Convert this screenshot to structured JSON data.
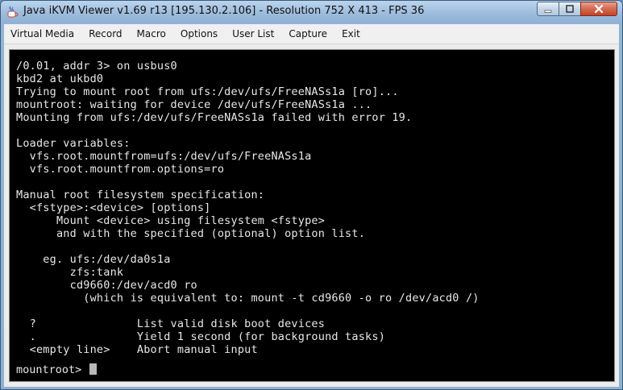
{
  "window": {
    "title": "Java iKVM Viewer v1.69 r13 [195.130.2.106]  - Resolution 752 X 413 - FPS 36",
    "app_icon": "java-cup-icon",
    "buttons": {
      "minimize_icon": "minimize-icon",
      "maximize_icon": "maximize-icon",
      "close_icon": "close-icon"
    }
  },
  "menubar": {
    "items": [
      {
        "label": "Virtual Media"
      },
      {
        "label": "Record"
      },
      {
        "label": "Macro"
      },
      {
        "label": "Options"
      },
      {
        "label": "User List"
      },
      {
        "label": "Capture"
      },
      {
        "label": "Exit"
      }
    ]
  },
  "console": {
    "lines": [
      "/0.01, addr 3> on usbus0",
      "kbd2 at ukbd0",
      "Trying to mount root from ufs:/dev/ufs/FreeNASs1a [ro]...",
      "mountroot: waiting for device /dev/ufs/FreeNASs1a ...",
      "Mounting from ufs:/dev/ufs/FreeNASs1a failed with error 19.",
      "",
      "Loader variables:",
      "  vfs.root.mountfrom=ufs:/dev/ufs/FreeNASs1a",
      "  vfs.root.mountfrom.options=ro",
      "",
      "Manual root filesystem specification:",
      "  <fstype>:<device> [options]",
      "      Mount <device> using filesystem <fstype>",
      "      and with the specified (optional) option list.",
      "",
      "    eg. ufs:/dev/da0s1a",
      "        zfs:tank",
      "        cd9660:/dev/acd0 ro",
      "          (which is equivalent to: mount -t cd9660 -o ro /dev/acd0 /)",
      "",
      "  ?               List valid disk boot devices",
      "  .               Yield 1 second (for background tasks)",
      "  <empty line>    Abort manual input"
    ],
    "prompt": "mountroot> "
  }
}
